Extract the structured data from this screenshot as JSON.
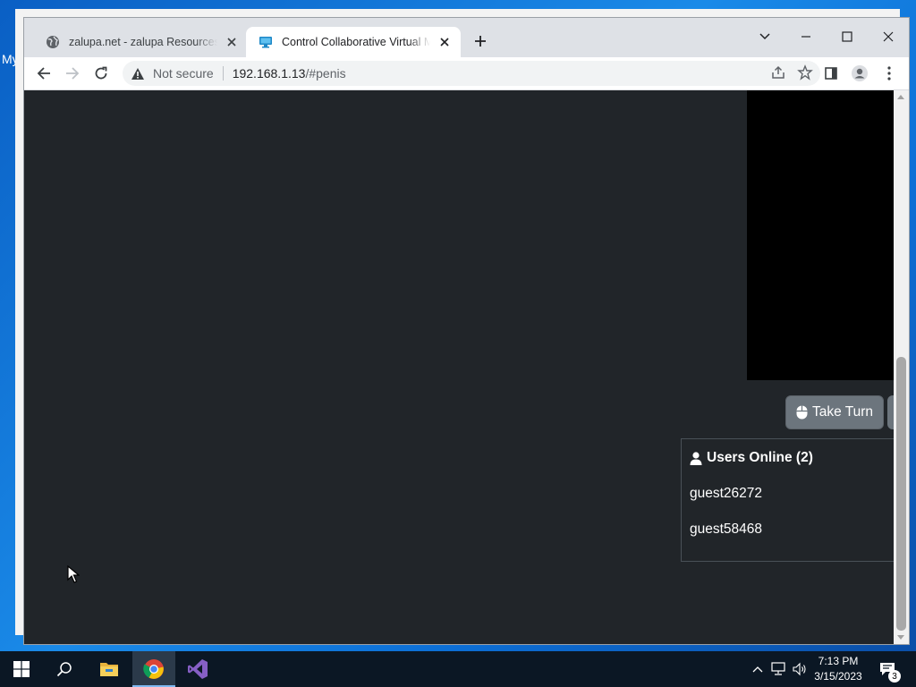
{
  "desktop": {
    "label": "My"
  },
  "browser": {
    "tabs": [
      {
        "title": "zalupa.net - zalupa Resources and",
        "active": false,
        "icon": "globe-icon"
      },
      {
        "title": "Control Collaborative Virtual Machine",
        "active": true,
        "icon": "monitor-icon"
      }
    ],
    "address_bar": {
      "security_label": "Not secure",
      "url_host": "192.168.1.13",
      "url_rest": "/#penis"
    }
  },
  "page": {
    "take_turn_label": "Take Turn",
    "users_online": {
      "title": "Users Online (2)",
      "users": [
        "guest26272",
        "guest58468"
      ]
    }
  },
  "taskbar": {
    "time": "7:13 PM",
    "date": "3/15/2023",
    "notification_count": "3"
  },
  "colors": {
    "page_bg": "#212529",
    "button_bg": "#6c757d",
    "panel_border": "#495057",
    "taskbar_bg": "#0b1724"
  }
}
